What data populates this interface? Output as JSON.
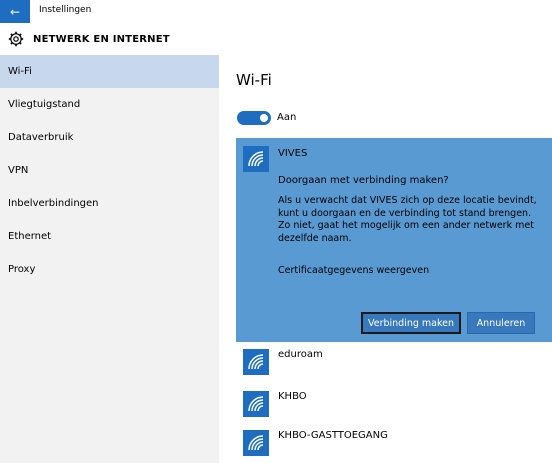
{
  "window": {
    "title": "Instellingen"
  },
  "header": {
    "title": "NETWERK EN INTERNET"
  },
  "sidebar": {
    "items": [
      {
        "label": "Wi-Fi",
        "active": true
      },
      {
        "label": "Vliegtuigstand"
      },
      {
        "label": "Dataverbruik"
      },
      {
        "label": "VPN"
      },
      {
        "label": "Inbelverbindingen"
      },
      {
        "label": "Ethernet"
      },
      {
        "label": "Proxy"
      }
    ]
  },
  "main": {
    "title": "Wi-Fi",
    "toggle": {
      "state": "on",
      "label": "Aan"
    },
    "selected_network": {
      "ssid": "VIVES",
      "question": "Doorgaan met verbinding maken?",
      "description": "Als u verwacht dat VIVES zich op deze locatie bevindt, kunt u doorgaan en de verbinding tot stand brengen. Zo niet, gaat het mogelijk om een ander netwerk met dezelfde naam.",
      "link": "Certificaatgegevens weergeven",
      "connect_label": "Verbinding maken",
      "cancel_label": "Annuleren"
    },
    "networks": [
      {
        "ssid": "eduroam"
      },
      {
        "ssid": "KHBO"
      },
      {
        "ssid": "KHBO-GASTTOEGANG"
      }
    ]
  },
  "colors": {
    "accent": "#1e6dc0",
    "card_bg": "#5a9ad3",
    "sidebar_bg": "#f2f2f2",
    "sidebar_active": "#c6d7ee"
  },
  "icons": {
    "back": "back-arrow-icon",
    "settings": "gear-icon",
    "network": "wifi-signal-icon"
  }
}
